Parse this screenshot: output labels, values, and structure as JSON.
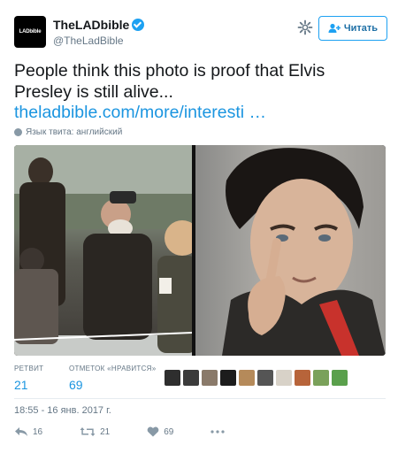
{
  "account": {
    "avatar_text": "LADbible",
    "display_name": "TheLADbible",
    "handle": "@TheLadBible",
    "verified": true
  },
  "follow_button": {
    "label": "Читать"
  },
  "tweet": {
    "text": "People think this photo is proof that Elvis Presley is still alive...",
    "link": "theladbible.com/more/interesti  …",
    "language": "Язык твита: английский"
  },
  "stats": {
    "retweets_label": "РЕТВИТ",
    "retweets_value": "21",
    "likes_label": "ОТМЕТОК «НРАВИТСЯ»",
    "likes_value": "69"
  },
  "timestamp": "18:55 - 16 янв. 2017 г.",
  "actions": {
    "reply_count": "16",
    "retweet_count": "21",
    "like_count": "69"
  },
  "colors": {
    "accent": "#1da1f2",
    "link": "#1b95e0",
    "muted": "#657786"
  }
}
